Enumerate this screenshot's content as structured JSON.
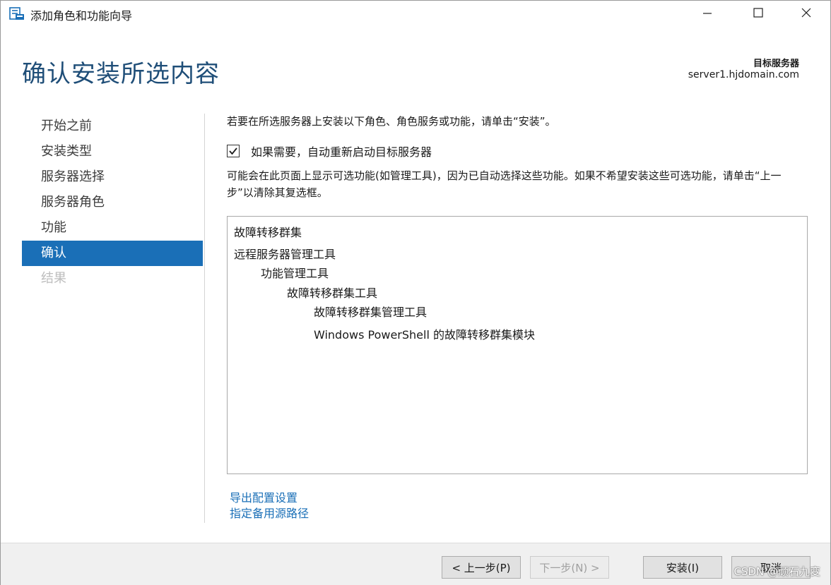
{
  "window": {
    "title": "添加角色和功能向导",
    "icon": "server-manager-icon"
  },
  "header": {
    "page_title": "确认安装所选内容",
    "target_server_label": "目标服务器",
    "target_server_value": "server1.hjdomain.com"
  },
  "nav": {
    "items": [
      {
        "label": "开始之前",
        "state": "normal"
      },
      {
        "label": "安装类型",
        "state": "normal"
      },
      {
        "label": "服务器选择",
        "state": "normal"
      },
      {
        "label": "服务器角色",
        "state": "normal"
      },
      {
        "label": "功能",
        "state": "normal"
      },
      {
        "label": "确认",
        "state": "active"
      },
      {
        "label": "结果",
        "state": "disabled"
      }
    ]
  },
  "content": {
    "intro": "若要在所选服务器上安装以下角色、角色服务或功能，请单击“安装”。",
    "restart_checkbox_label": "如果需要，自动重新启动目标服务器",
    "restart_checked": true,
    "note": "可能会在此页面上显示可选功能(如管理工具)，因为已自动选择这些功能。如果不希望安装这些可选功能，请单击“上一步”以清除其复选框。",
    "features": [
      {
        "label": "故障转移群集",
        "level": 0
      },
      {
        "label": "远程服务器管理工具",
        "level": 0
      },
      {
        "label": "功能管理工具",
        "level": 1
      },
      {
        "label": "故障转移群集工具",
        "level": 2
      },
      {
        "label": "故障转移群集管理工具",
        "level": 3
      },
      {
        "label": "Windows PowerShell 的故障转移群集模块",
        "level": 3
      }
    ],
    "links": {
      "export": "导出配置设置",
      "alternate_source": "指定备用源路径"
    }
  },
  "footer": {
    "prev": "< 上一步(P)",
    "next": "下一步(N) >",
    "install": "安装(I)",
    "cancel": "取消"
  },
  "watermark": "CSDN @顽石九变",
  "colors": {
    "accent": "#1a6fb7",
    "title": "#1f4e78",
    "footer_bg": "#f0f0f0"
  }
}
